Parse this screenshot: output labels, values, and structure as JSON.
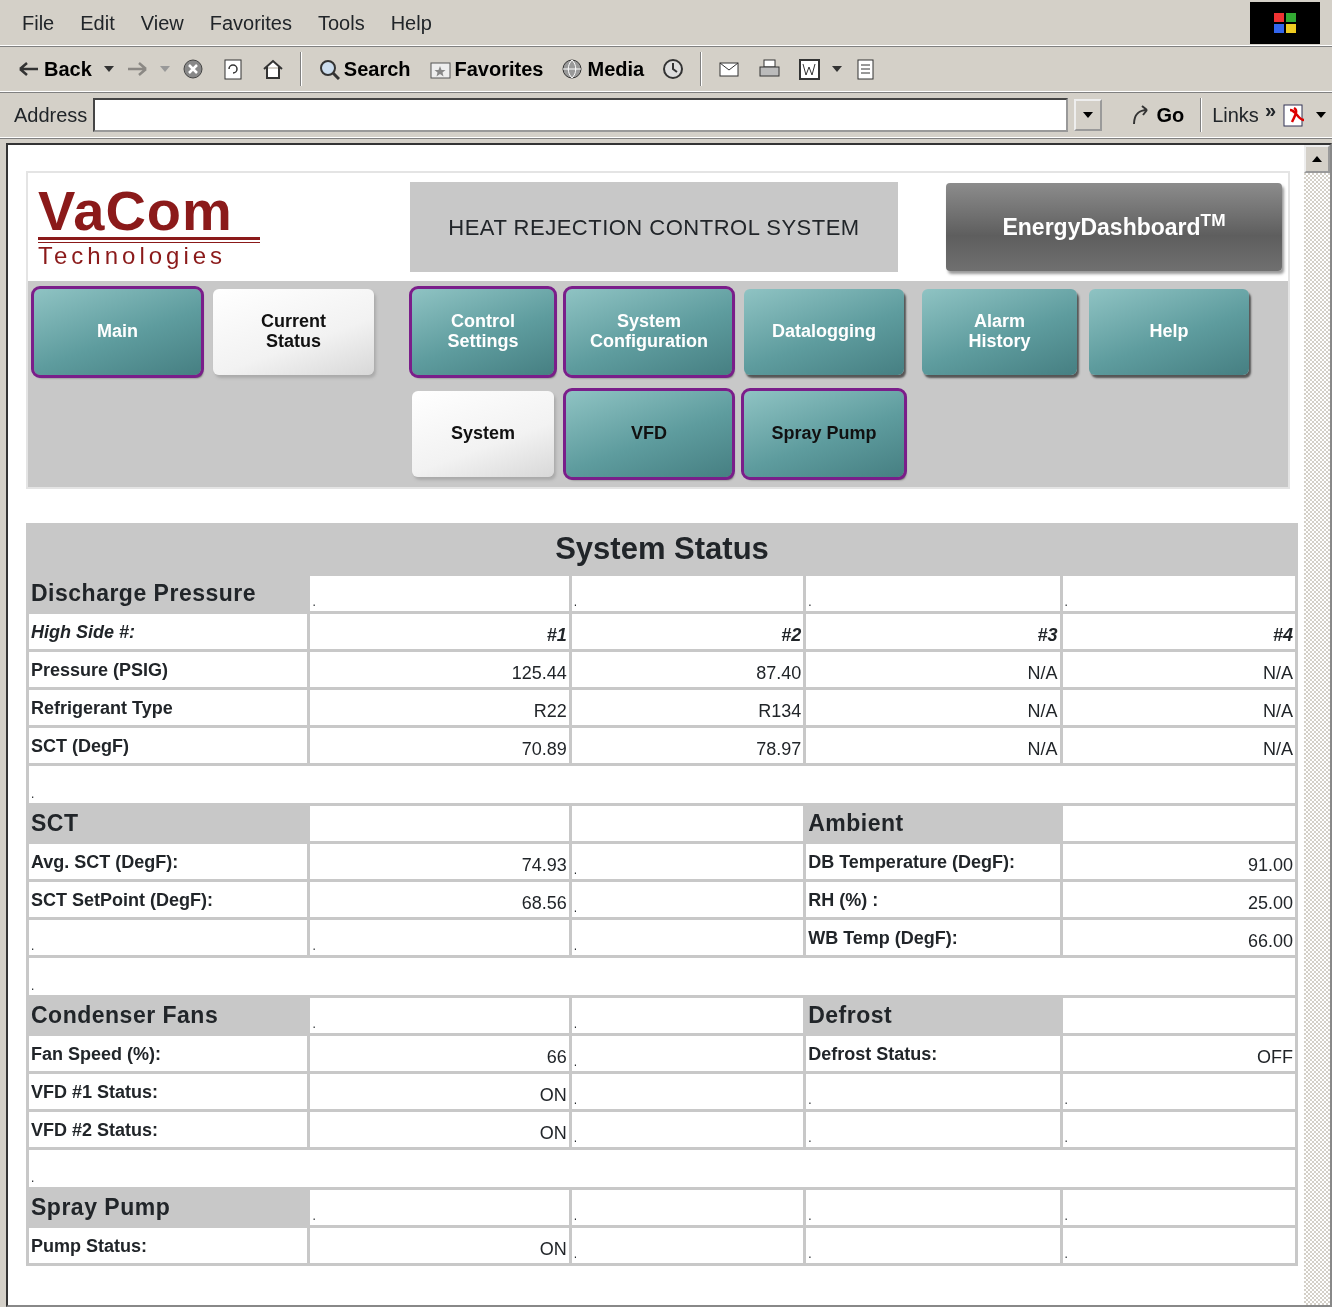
{
  "browser": {
    "menu": [
      "File",
      "Edit",
      "View",
      "Favorites",
      "Tools",
      "Help"
    ],
    "toolbar": [
      {
        "kind": "back",
        "label": "Back",
        "disabled": false
      },
      {
        "kind": "forward",
        "disabled": true
      },
      {
        "kind": "stop",
        "disabled": false
      },
      {
        "kind": "refresh",
        "disabled": false
      },
      {
        "kind": "home",
        "disabled": false
      },
      {
        "kind": "sep"
      },
      {
        "kind": "search",
        "label": "Search",
        "disabled": false
      },
      {
        "kind": "favorites",
        "label": "Favorites",
        "disabled": false
      },
      {
        "kind": "media",
        "label": "Media",
        "disabled": false
      },
      {
        "kind": "history",
        "disabled": false
      },
      {
        "kind": "sep"
      },
      {
        "kind": "mail",
        "disabled": false
      },
      {
        "kind": "print",
        "disabled": false
      },
      {
        "kind": "edit",
        "disabled": false
      },
      {
        "kind": "discuss",
        "disabled": false
      }
    ],
    "address": {
      "label": "Address",
      "go": "Go",
      "links": "Links",
      "more": "»"
    }
  },
  "header": {
    "logo": {
      "name": "VaCom",
      "tagline": "Technologies"
    },
    "title": "HEAT REJECTION CONTROL SYSTEM",
    "dashboard": "EnergyDashboard$^{TM}$"
  },
  "nav": [
    {
      "label": "Main",
      "selected": false,
      "outlined": true
    },
    {
      "label": "Current Status",
      "selected": true,
      "outlined": false
    },
    {
      "label": "Control Settings",
      "selected": false,
      "outlined": true
    },
    {
      "label": "System Configuration",
      "selected": false,
      "outlined": true
    },
    {
      "label": "Datalogging",
      "selected": false,
      "outlined": false
    },
    {
      "label": "Alarm History",
      "selected": false,
      "outlined": false
    },
    {
      "label": "Help",
      "selected": false,
      "outlined": false
    }
  ],
  "subnav": [
    {
      "label": "System",
      "selected": true,
      "outlined": false
    },
    {
      "label": "VFD",
      "selected": false,
      "outlined": true
    },
    {
      "label": "Spray Pump",
      "selected": false,
      "outlined": true
    }
  ],
  "table": {
    "title": "System Status",
    "rows": [
      {
        "kind": "cells",
        "cells": [
          {
            "kind": "section",
            "text": "Discharge Pressure"
          },
          {
            "kind": "dot",
            "text": "."
          },
          {
            "kind": "dot",
            "text": "."
          },
          {
            "kind": "dot",
            "text": "."
          },
          {
            "kind": "dot",
            "text": "."
          }
        ]
      },
      {
        "kind": "cells",
        "cells": [
          {
            "kind": "sub",
            "text": "High Side #:"
          },
          {
            "kind": "subnum",
            "text": "#1"
          },
          {
            "kind": "subnum",
            "text": "#2"
          },
          {
            "kind": "subnum",
            "text": "#3"
          },
          {
            "kind": "subnum",
            "text": "#4"
          }
        ]
      },
      {
        "kind": "cells",
        "cells": [
          {
            "kind": "label",
            "text": "Pressure (PSIG)"
          },
          {
            "kind": "num",
            "text": "125.44"
          },
          {
            "kind": "num",
            "text": "87.40"
          },
          {
            "kind": "num",
            "text": "N/A"
          },
          {
            "kind": "num",
            "text": "N/A"
          }
        ]
      },
      {
        "kind": "cells",
        "cells": [
          {
            "kind": "label",
            "text": "Refrigerant Type"
          },
          {
            "kind": "num",
            "text": "R22"
          },
          {
            "kind": "num",
            "text": "R134"
          },
          {
            "kind": "num",
            "text": "N/A"
          },
          {
            "kind": "num",
            "text": "N/A"
          }
        ]
      },
      {
        "kind": "cells",
        "cells": [
          {
            "kind": "label",
            "text": "SCT (DegF)"
          },
          {
            "kind": "num",
            "text": "70.89"
          },
          {
            "kind": "num",
            "text": "78.97"
          },
          {
            "kind": "num",
            "text": "N/A"
          },
          {
            "kind": "num",
            "text": "N/A"
          }
        ]
      },
      {
        "kind": "spacer",
        "text": "."
      },
      {
        "kind": "cells",
        "cells": [
          {
            "kind": "section",
            "text": "SCT"
          },
          {
            "kind": "empty"
          },
          {
            "kind": "empty"
          },
          {
            "kind": "section",
            "text": "Ambient"
          },
          {
            "kind": "empty"
          }
        ]
      },
      {
        "kind": "cells",
        "cells": [
          {
            "kind": "label",
            "text": "Avg. SCT (DegF):"
          },
          {
            "kind": "num",
            "text": "74.93"
          },
          {
            "kind": "dot",
            "text": "."
          },
          {
            "kind": "label",
            "text": "DB Temperature (DegF):"
          },
          {
            "kind": "num",
            "text": "91.00"
          }
        ]
      },
      {
        "kind": "cells",
        "cells": [
          {
            "kind": "label",
            "text": "SCT SetPoint (DegF):"
          },
          {
            "kind": "num",
            "text": "68.56"
          },
          {
            "kind": "dot",
            "text": "."
          },
          {
            "kind": "label",
            "text": "RH (%) :"
          },
          {
            "kind": "num",
            "text": "25.00"
          }
        ]
      },
      {
        "kind": "cells",
        "cells": [
          {
            "kind": "dot",
            "text": "."
          },
          {
            "kind": "dot",
            "text": "."
          },
          {
            "kind": "dot",
            "text": "."
          },
          {
            "kind": "label",
            "text": "WB Temp (DegF):"
          },
          {
            "kind": "num",
            "text": "66.00"
          }
        ]
      },
      {
        "kind": "spacer",
        "text": "."
      },
      {
        "kind": "cells",
        "cells": [
          {
            "kind": "section",
            "text": "Condenser Fans"
          },
          {
            "kind": "dot",
            "text": "."
          },
          {
            "kind": "dot",
            "text": "."
          },
          {
            "kind": "section",
            "text": "Defrost"
          },
          {
            "kind": "empty"
          }
        ]
      },
      {
        "kind": "cells",
        "cells": [
          {
            "kind": "label",
            "text": "Fan Speed (%):"
          },
          {
            "kind": "num",
            "text": "66"
          },
          {
            "kind": "dot",
            "text": "."
          },
          {
            "kind": "label",
            "text": "Defrost Status:"
          },
          {
            "kind": "num",
            "text": "OFF"
          }
        ]
      },
      {
        "kind": "cells",
        "cells": [
          {
            "kind": "label",
            "text": "VFD #1 Status:"
          },
          {
            "kind": "num",
            "text": "ON"
          },
          {
            "kind": "dot",
            "text": "."
          },
          {
            "kind": "dot",
            "text": "."
          },
          {
            "kind": "dot",
            "text": "."
          }
        ]
      },
      {
        "kind": "cells",
        "cells": [
          {
            "kind": "label",
            "text": "VFD #2 Status:"
          },
          {
            "kind": "num",
            "text": "ON"
          },
          {
            "kind": "dot",
            "text": "."
          },
          {
            "kind": "dot",
            "text": "."
          },
          {
            "kind": "dot",
            "text": "."
          }
        ]
      },
      {
        "kind": "spacer",
        "text": "."
      },
      {
        "kind": "cells",
        "cells": [
          {
            "kind": "section",
            "text": "Spray Pump"
          },
          {
            "kind": "dot",
            "text": "."
          },
          {
            "kind": "dot",
            "text": "."
          },
          {
            "kind": "dot",
            "text": "."
          },
          {
            "kind": "dot",
            "text": "."
          }
        ]
      },
      {
        "kind": "cells",
        "cells": [
          {
            "kind": "label",
            "text": "Pump Status:"
          },
          {
            "kind": "num",
            "text": "ON"
          },
          {
            "kind": "dot",
            "text": "."
          },
          {
            "kind": "dot",
            "text": "."
          },
          {
            "kind": "dot",
            "text": "."
          }
        ]
      }
    ]
  }
}
